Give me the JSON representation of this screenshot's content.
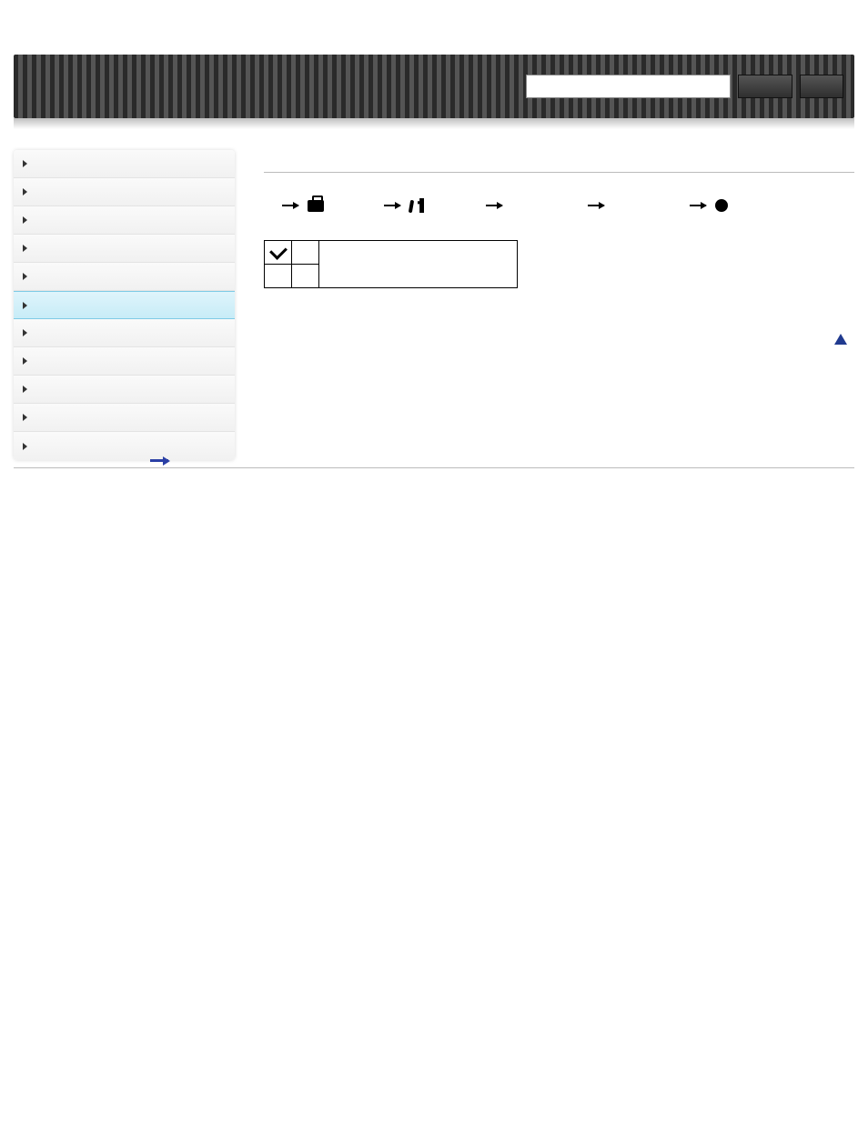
{
  "header": {
    "search_placeholder": "",
    "btn1_label": "",
    "btn2_label": ""
  },
  "sidebar": {
    "items": [
      {
        "label": ""
      },
      {
        "label": ""
      },
      {
        "label": ""
      },
      {
        "label": ""
      },
      {
        "label": ""
      },
      {
        "label": ""
      },
      {
        "label": ""
      },
      {
        "label": ""
      },
      {
        "label": ""
      },
      {
        "label": ""
      },
      {
        "label": ""
      }
    ],
    "active_index": 5
  },
  "main": {
    "title": "",
    "nav": {
      "step1": "",
      "step2": "",
      "step3": "",
      "step4": "",
      "step5": ""
    },
    "table": {
      "row1": {
        "c2": "",
        "c3": ""
      },
      "row2": {
        "c1": "",
        "c2": "",
        "c3": ""
      }
    },
    "footer_link": ""
  }
}
